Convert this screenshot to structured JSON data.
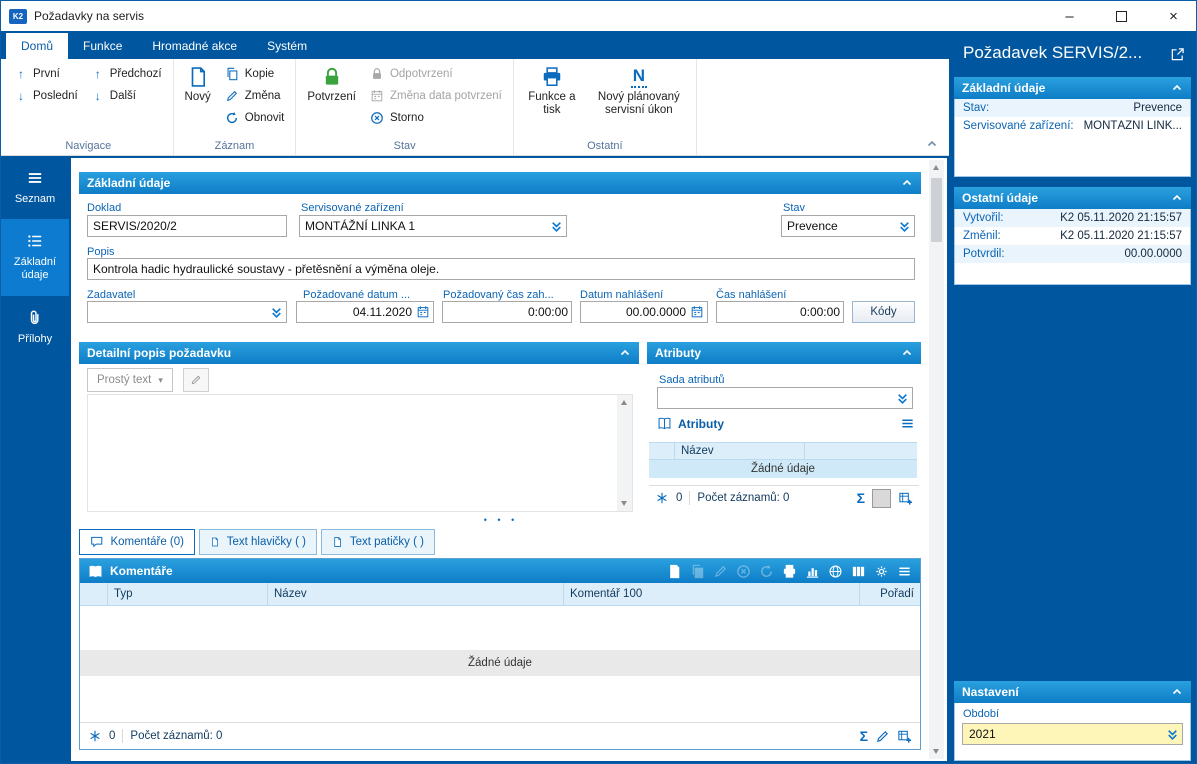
{
  "colors": {
    "accent_blue": "#0063b1",
    "panel_blue": "#00579f",
    "header_blue": "#1b8ad2",
    "highlight_yellow": "#fdf6b8",
    "confirm_green": "#3aa43c"
  },
  "window": {
    "title": "Požadavky na servis"
  },
  "icons": {
    "minimize": "–",
    "close": "×",
    "up": "↑",
    "down": "↓",
    "sigma": "Σ",
    "caret": "▾",
    "splitter": "• • •"
  },
  "ribbon": {
    "tabs": {
      "domu": "Domů",
      "funkce": "Funkce",
      "hromadne": "Hromadné akce",
      "system": "Systém"
    },
    "navigace": {
      "group": "Navigace",
      "prvni": "První",
      "posledni": "Poslední",
      "predchozi": "Předchozí",
      "dalsi": "Další"
    },
    "zaznam": {
      "group": "Záznam",
      "novy": "Nový",
      "kopie": "Kopie",
      "zmena": "Změna",
      "obnovit": "Obnovit"
    },
    "stav": {
      "group": "Stav",
      "potvrzeni": "Potvrzení",
      "odpotvrzeni": "Odpotvrzení",
      "zmena_data": "Změna data potvrzení",
      "storno": "Storno"
    },
    "ostatni": {
      "group": "Ostatní",
      "funkce_a_tisk": "Funkce a tisk",
      "novy_ukon": "Nový plánovaný servisní úkon"
    }
  },
  "sidebar": {
    "seznam": "Seznam",
    "zakladni_udaje": "Základní údaje",
    "prilohy": "Přílohy"
  },
  "form": {
    "section_title": "Základní údaje",
    "doklad_label": "Doklad",
    "doklad_value": "SERVIS/2020/2",
    "zarizeni_label": "Servisované zařízení",
    "zarizeni_value": "MONTÁŽNÍ LINKA 1",
    "stav_label": "Stav",
    "stav_value": "Prevence",
    "popis_label": "Popis",
    "popis_value": "Kontrola hadic hydraulické soustavy - přetěsnění a výměna oleje.",
    "zadavatel_label": "Zadavatel",
    "datum_label": "Požadované datum ...",
    "datum_value": "04.11.2020",
    "cas_zah_label": "Požadovaný čas zah...",
    "cas_zah_value": "0:00:00",
    "datum_nahl_label": "Datum nahlášení",
    "datum_nahl_value": "00.00.0000",
    "cas_nahl_label": "Čas nahlášení",
    "cas_nahl_value": "0:00:00",
    "kody_button": "Kódy"
  },
  "detail": {
    "title": "Detailní popis požadavku",
    "tab": "Prostý text"
  },
  "atributy": {
    "title": "Atributy",
    "sada_label": "Sada atributů",
    "grid_title": "Atributy",
    "col_nazev": "Název",
    "no_data": "Žádné údaje",
    "count": "0",
    "count_label": "Počet záznamů: 0"
  },
  "tabs": {
    "komentare": "Komentáře (0)",
    "hlavicky": "Text hlavičky ( )",
    "paticka": "Text patičky ( )"
  },
  "komentare": {
    "title": "Komentáře",
    "col_typ": "Typ",
    "col_nazev": "Název",
    "col_komentar": "Komentář 100",
    "col_poradi": "Pořadí",
    "no_data": "Žádné údaje",
    "count": "0",
    "count_label": "Počet záznamů: 0"
  },
  "panel": {
    "title": "Požadavek SERVIS/2...",
    "zakladni": {
      "title": "Základní údaje",
      "stav_label": "Stav:",
      "stav_value": "Prevence",
      "zarizeni_label": "Servisované zařízení:",
      "zarizeni_value": "MONTÁŽNÍ LINK..."
    },
    "ostatni": {
      "title": "Ostatní údaje",
      "vytvoril_label": "Vytvořil:",
      "vytvoril_value": "K2 05.11.2020 21:15:57",
      "zmenil_label": "Změnil:",
      "zmenil_value": "K2 05.11.2020 21:15:57",
      "potvrdil_label": "Potvrdil:",
      "potvrdil_value": "00.00.0000"
    },
    "nastaveni": {
      "title": "Nastavení",
      "obdobi_label": "Období",
      "obdobi_value": "2021"
    }
  }
}
